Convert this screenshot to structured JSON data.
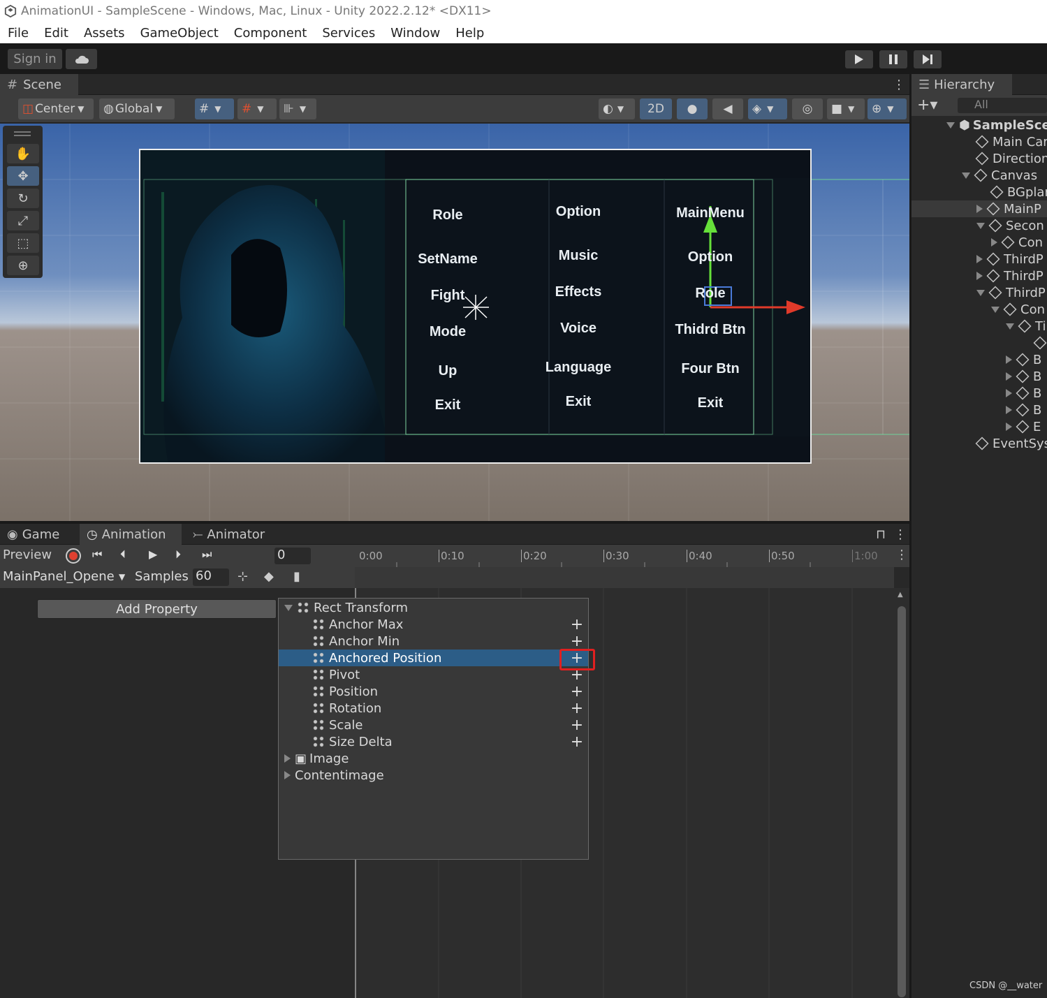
{
  "window": {
    "title": "AnimationUI - SampleScene - Windows, Mac, Linux - Unity 2022.2.12* <DX11>"
  },
  "menu": [
    "File",
    "Edit",
    "Assets",
    "GameObject",
    "Component",
    "Services",
    "Window",
    "Help"
  ],
  "toolbar": {
    "signin": "Sign in"
  },
  "scene": {
    "tab": "Scene",
    "center": "Center",
    "global": "Global",
    "mode2d": "2D"
  },
  "ui_columns": {
    "col1": [
      "Role",
      "SetName",
      "Fight",
      "Mode",
      "Up",
      "Exit"
    ],
    "col2": [
      "Option",
      "Music",
      "Effects",
      "Voice",
      "Language",
      "Exit"
    ],
    "col3": [
      "MainMenu",
      "Option",
      "Role",
      "Thidrd Btn",
      "Four Btn",
      "Exit"
    ]
  },
  "hierarchy": {
    "tab": "Hierarchy",
    "search": "All",
    "items": [
      "SampleSce",
      "Main Car",
      "Direction",
      "Canvas",
      "BGplar",
      "MainP",
      "Secon",
      "Con",
      "ThirdP",
      "ThirdP",
      "ThirdP",
      "Con",
      "Ti",
      "",
      "B",
      "B",
      "B",
      "B",
      "E",
      "EventSys"
    ]
  },
  "animpanel": {
    "tabs": [
      "Game",
      "Animation",
      "Animator"
    ],
    "preview": "Preview",
    "frame": "0",
    "clip": "MainPanel_Opene",
    "samples_label": "Samples",
    "samples": "60",
    "ticks": [
      "0:00",
      "0:10",
      "0:20",
      "0:30",
      "0:40",
      "0:50",
      "1:00"
    ],
    "add_property": "Add Property",
    "props": {
      "group": "Rect Transform",
      "items": [
        "Anchor Max",
        "Anchor Min",
        "Anchored Position",
        "Pivot",
        "Position",
        "Rotation",
        "Scale",
        "Size Delta"
      ],
      "others": [
        "Image",
        "Contentimage"
      ]
    }
  },
  "watermark": "CSDN @__water"
}
